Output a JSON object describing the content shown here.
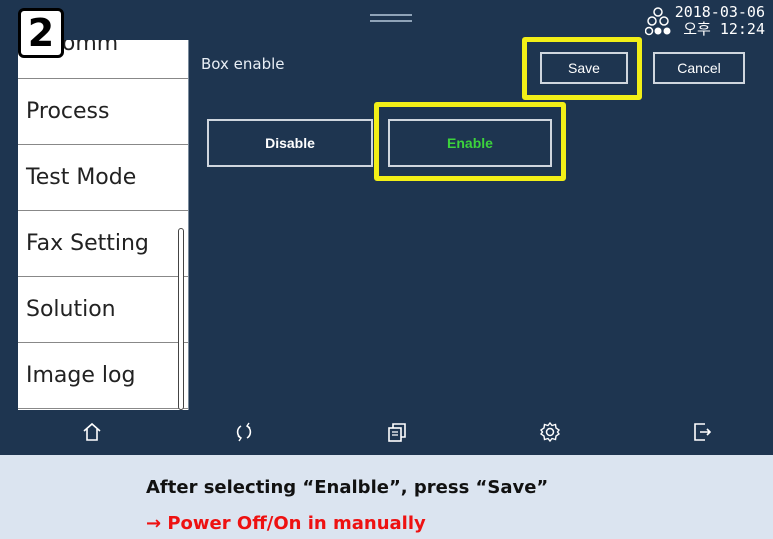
{
  "step_badge": "2",
  "status_bar": {
    "date": "2018-03-06",
    "time": "오후 12:24",
    "network_icon": "network-status-icon"
  },
  "sidebar": {
    "items": [
      {
        "label": "e Comm",
        "partial": true
      },
      {
        "label": "Process"
      },
      {
        "label": "Test Mode"
      },
      {
        "label": "Fax Setting"
      },
      {
        "label": "Solution"
      },
      {
        "label": "Image log"
      }
    ]
  },
  "main": {
    "title": "Box enable",
    "save_label": "Save",
    "cancel_label": "Cancel",
    "disable_label": "Disable",
    "enable_label": "Enable",
    "enable_color": "#3cd33c"
  },
  "navbar": {
    "icons": [
      "home-icon",
      "refresh-icon",
      "job-status-icon",
      "settings-icon",
      "logout-icon"
    ]
  },
  "instructions": {
    "line1": "After selecting “Enalble”,  press “Save”",
    "line2": "→ Power Off/On in manually",
    "line2_color": "#ee1111"
  },
  "highlight_color": "#f2ef17"
}
